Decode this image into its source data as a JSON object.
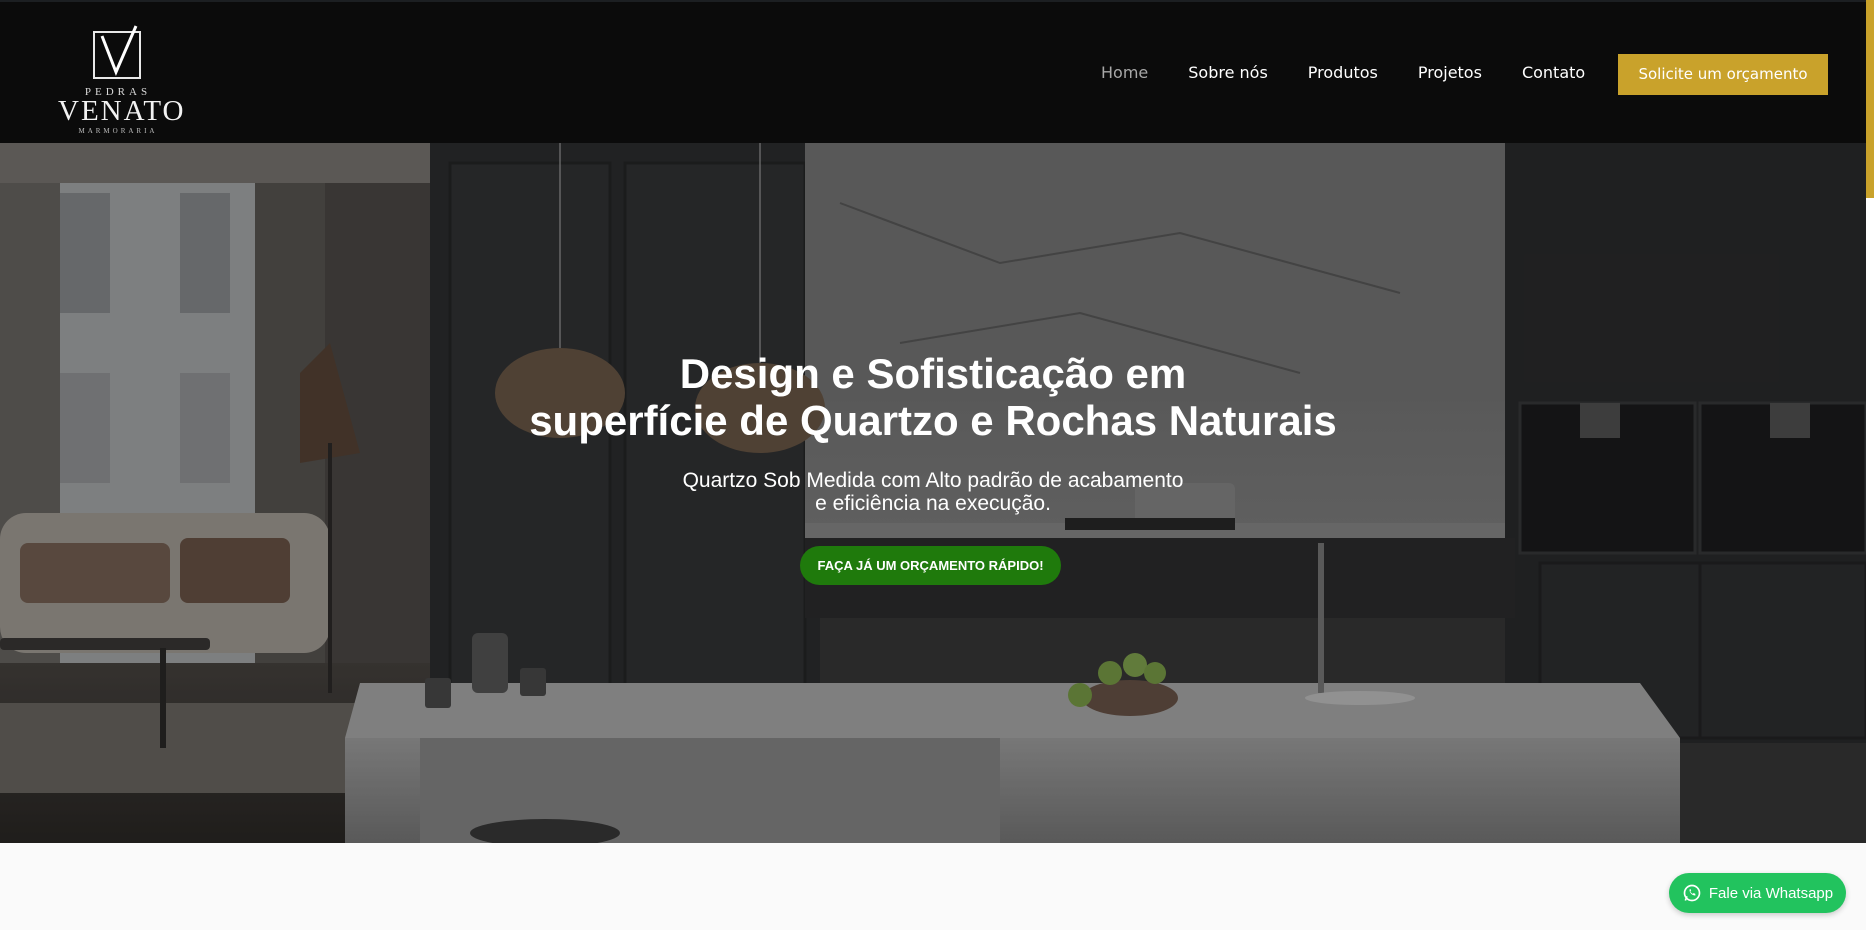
{
  "brand": {
    "logo_top": "PEDRAS",
    "logo_main": "VENATO",
    "logo_sub": "MARMORARIA",
    "accent_color": "#c9a22b"
  },
  "nav": {
    "items": [
      {
        "label": "Home",
        "active": true
      },
      {
        "label": "Sobre nós",
        "active": false
      },
      {
        "label": "Produtos",
        "active": false
      },
      {
        "label": "Projetos",
        "active": false
      },
      {
        "label": "Contato",
        "active": false
      }
    ],
    "cta_label": "Solicite um orçamento"
  },
  "hero": {
    "title_line1": "Design e Sofisticação em",
    "title_line2": "superfície de Quartzo e Rochas Naturais",
    "subtitle_line1": "Quartzo Sob Medida com Alto padrão de acabamento",
    "subtitle_line2": "e eficiência na execução.",
    "button_label": "FAÇA JÁ UM ORÇAMENTO RÁPIDO!",
    "button_color": "#1f7a0c"
  },
  "whatsapp": {
    "label": "Fale via Whatsapp",
    "icon": "whatsapp-icon",
    "color": "#22c35e"
  }
}
